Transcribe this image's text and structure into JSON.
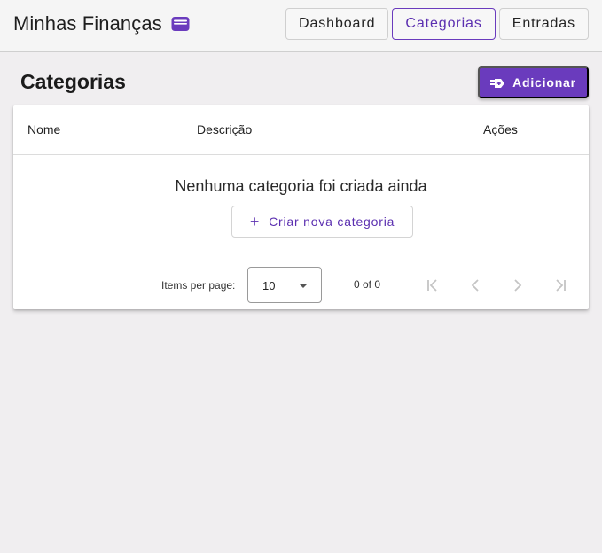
{
  "header": {
    "brand_title": "Minhas Finanças",
    "brand_icon": "wallet-icon",
    "nav": [
      {
        "label": "Dashboard",
        "active": false
      },
      {
        "label": "Categorias",
        "active": true
      },
      {
        "label": "Entradas",
        "active": false
      }
    ]
  },
  "page": {
    "title": "Categorias",
    "add_button": {
      "label": "Adicionar",
      "icon": "add-icon"
    }
  },
  "table": {
    "columns": [
      "Nome",
      "Descrição",
      "Ações"
    ],
    "rows": [],
    "empty_message": "Nenhuma categoria foi criada ainda",
    "create_button": {
      "label": "Criar nova categoria",
      "icon": "plus-icon"
    }
  },
  "paginator": {
    "items_per_page_label": "Items per page:",
    "page_size": "10",
    "range_label": "0 of 0"
  },
  "colors": {
    "accent": "#6a3bbd",
    "background": "#f0eef0",
    "header": "#f5f5f5",
    "card": "#ffffff"
  }
}
